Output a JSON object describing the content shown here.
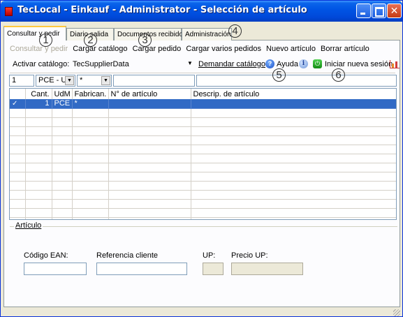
{
  "window": {
    "title": "TecLocal - Einkauf - Administrator - Selección de artículo"
  },
  "tabs": [
    {
      "label": "Consultar y pedir",
      "active": true
    },
    {
      "label": "Diario salida",
      "active": false
    },
    {
      "label": "Documentos recibidos",
      "active": false
    },
    {
      "label": "Administración",
      "active": false
    }
  ],
  "toolbar": {
    "consultar_pedir": "Consultar y pedir",
    "cargar_catalogo": "Cargar catálogo",
    "cargar_pedido": "Cargar pedido",
    "cargar_varios": "Cargar varios pedidos",
    "nuevo_articulo": "Nuevo artículo",
    "borrar_articulo": "Borrar artículo"
  },
  "catalog": {
    "label": "Activar catálogo:",
    "value": "TecSupplierData",
    "demand": "Demandar catálogo",
    "help": "Ayuda",
    "new_session": "Iniciar nueva sesión"
  },
  "filters": {
    "qty": "1",
    "uom": "PCE - Ui",
    "manufacturer": "*",
    "article": "",
    "description": ""
  },
  "grid": {
    "columns": [
      "",
      "Cant.",
      "UdM",
      "Fabrican.",
      "N° de artículo",
      "Descrip. de artículo"
    ],
    "rows": [
      {
        "check": "✓",
        "qty": "1",
        "uom": "PCE",
        "mfr": "*",
        "article": "",
        "desc": ""
      }
    ],
    "empty_rows": 13
  },
  "articulo": {
    "title": "Artículo",
    "ean_label": "Código EAN:",
    "ref_label": "Referencia cliente",
    "up_label": "UP:",
    "price_label": "Precio UP:",
    "ean_value": "",
    "ref_value": "",
    "up_value": "",
    "price_value": ""
  },
  "callouts": [
    "1",
    "2",
    "3",
    "4",
    "5",
    "6"
  ],
  "colors": {
    "title_bar": "#0055e5",
    "selection": "#316ac5",
    "tab_highlight": "#ffc83c"
  }
}
